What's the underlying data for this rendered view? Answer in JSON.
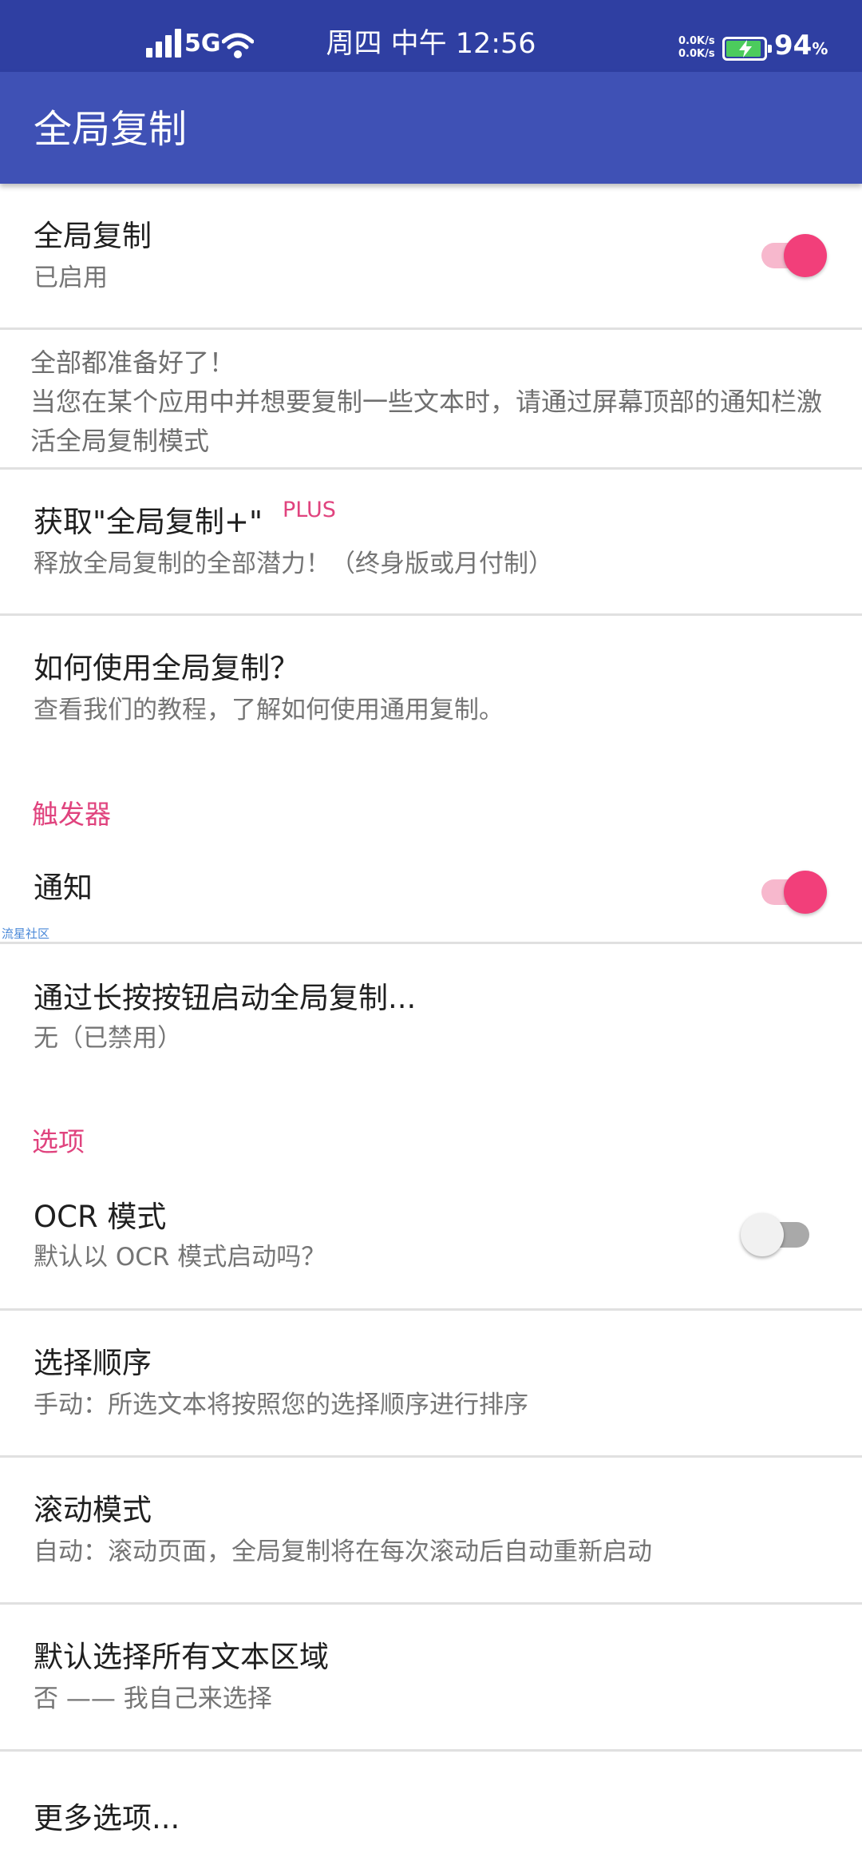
{
  "status_bar": {
    "network": "5G",
    "time": "周四 中午 12:56",
    "upload_speed": "0.0K/s",
    "download_speed": "0.0K/s",
    "battery_percent": "94",
    "battery_unit": "%",
    "battery_level": 0.94,
    "icons": [
      "signal-icon",
      "wifi-icon",
      "battery-charging-icon"
    ]
  },
  "app_bar": {
    "title": "全局复制"
  },
  "main": {
    "enable": {
      "title": "全局复制",
      "subtitle": "已启用",
      "switch_on": true
    },
    "info": "全部都准备好了！\n当您在某个应用中并想要复制一些文本时，请通过屏幕顶部的通知栏激活全局复制模式",
    "plus": {
      "title": "获取\"全局复制+\"",
      "tag": "PLUS",
      "subtitle": "释放全局复制的全部潜力！（终身版或月付制）"
    },
    "howto": {
      "title": "如何使用全局复制？",
      "subtitle": "查看我们的教程，了解如何使用通用复制。"
    }
  },
  "triggers": {
    "header": "触发器",
    "notification": {
      "title": "通知",
      "switch_on": true
    },
    "longpress": {
      "title": "通过长按按钮启动全局复制...",
      "subtitle": "无（已禁用）"
    }
  },
  "options": {
    "header": "选项",
    "ocr": {
      "title": "OCR 模式",
      "subtitle": "默认以 OCR 模式启动吗？",
      "switch_on": false
    },
    "order": {
      "title": "选择顺序",
      "subtitle": "手动：所选文本将按照您的选择顺序进行排序"
    },
    "scroll": {
      "title": "滚动模式",
      "subtitle": "自动：滚动页面，全局复制将在每次滚动后自动重新启动"
    },
    "select_all": {
      "title": "默认选择所有文本区域",
      "subtitle": "否 —— 我自己来选择"
    },
    "more": {
      "title": "更多选项..."
    }
  },
  "watermark": "流星社区",
  "colors": {
    "status_bar": "#2f3fa2",
    "app_bar": "#3f51b5",
    "accent": "#e0437e",
    "switch_on_thumb": "#f23f7a",
    "switch_on_track": "#f7b8cd"
  }
}
